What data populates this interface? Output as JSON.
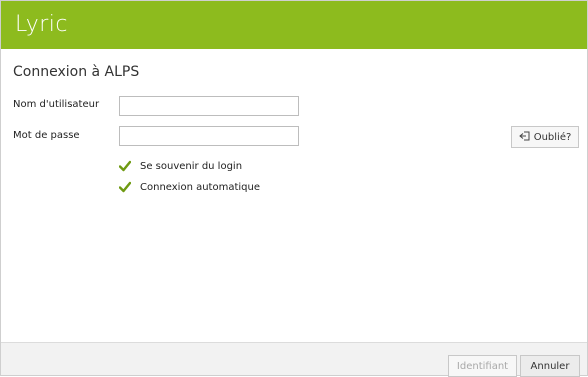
{
  "app": {
    "logo_text": "Lyric",
    "brand_color": "#8dbb1e"
  },
  "page": {
    "title": "Connexion à ALPS"
  },
  "form": {
    "username_label": "Nom d'utilisateur",
    "username_value": "",
    "password_label": "Mot de passe",
    "password_value": "",
    "remember_label": "Se souvenir du login",
    "remember_checked": true,
    "autologin_label": "Connexion automatique",
    "autologin_checked": true
  },
  "forgot": {
    "label": "Oublié?",
    "icon": "sign-in-arrow-icon"
  },
  "footer": {
    "login_label": "Identifiant",
    "login_enabled": false,
    "cancel_label": "Annuler"
  }
}
